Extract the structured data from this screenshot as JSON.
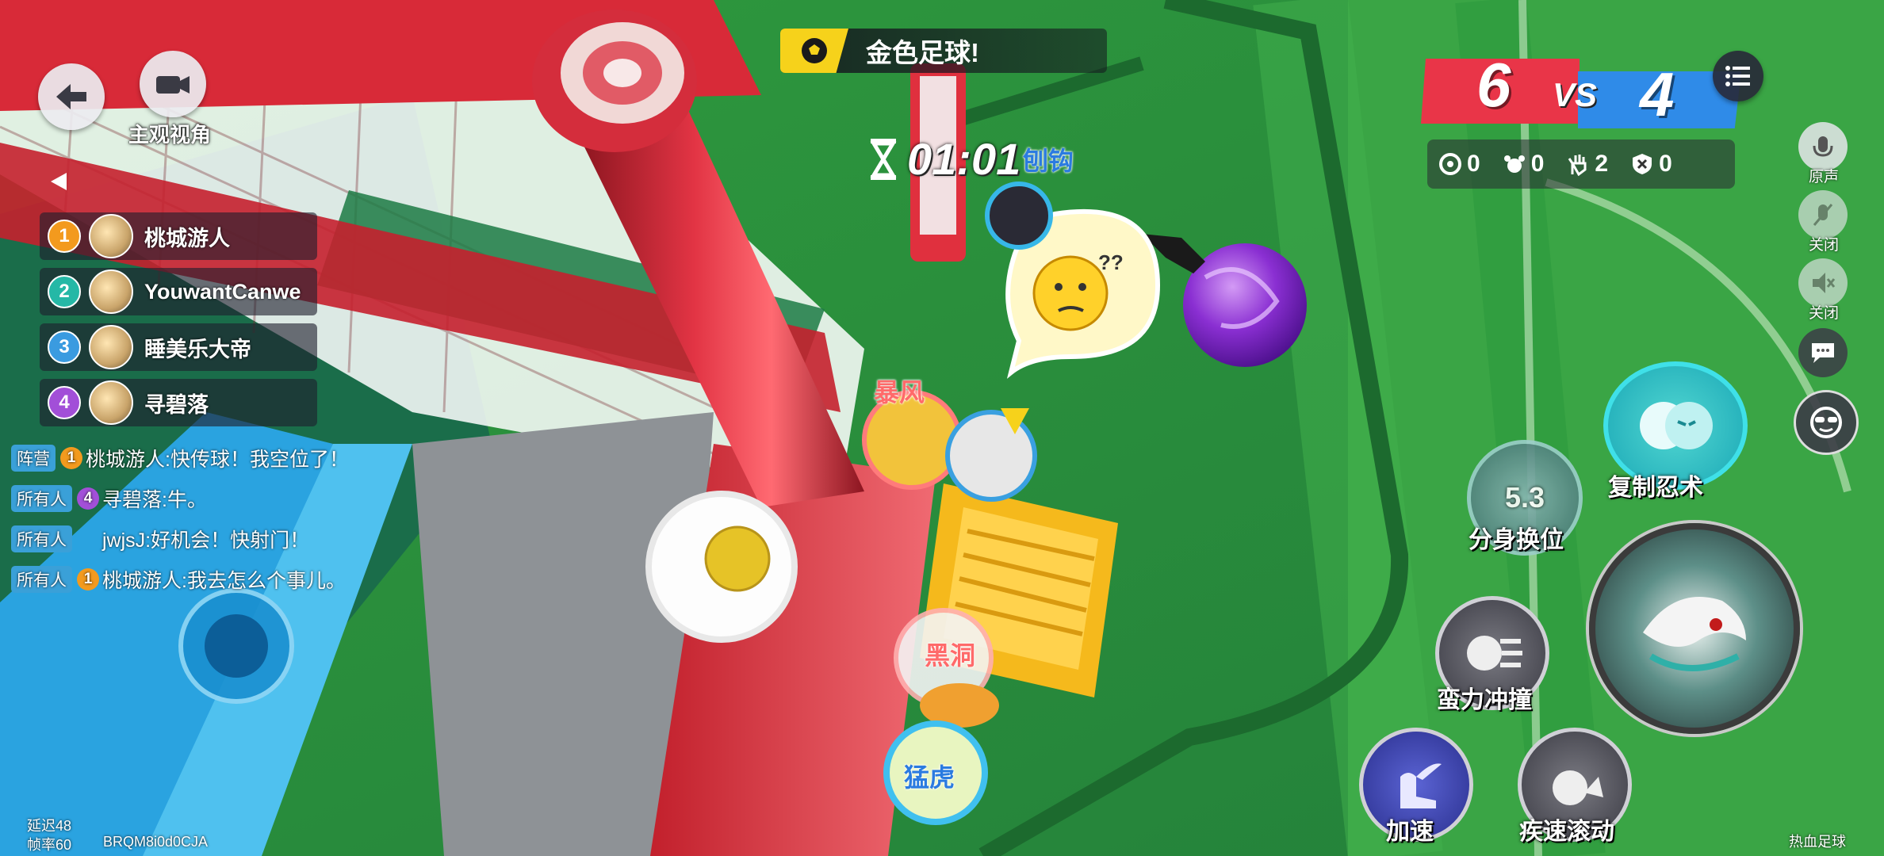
{
  "top_left": {
    "perspective_label": "主观视角"
  },
  "players": [
    {
      "rank": "1",
      "name": "桃城游人",
      "color": "#f39a1e"
    },
    {
      "rank": "2",
      "name": "YouwantCanwe",
      "color": "#25b8a6"
    },
    {
      "rank": "3",
      "name": "睡美乐大帝",
      "color": "#3a9be0"
    },
    {
      "rank": "4",
      "name": "寻碧落",
      "color": "#a24fd8"
    }
  ],
  "chat": [
    {
      "tag": "阵营",
      "rank": "1",
      "text": "桃城游人:快传球！我空位了！"
    },
    {
      "tag": "所有人",
      "rank": "4",
      "text": "寻碧落:牛。"
    },
    {
      "tag": "所有人",
      "rank": "",
      "text": "jwjsJ:好机会！快射门！"
    },
    {
      "tag": "所有人",
      "rank": "1",
      "text": "桃城游人:我去怎么个事儿。"
    }
  ],
  "banner": {
    "text": "金色足球!"
  },
  "timer": {
    "text": "01:01"
  },
  "scoreboard": {
    "red_score": "6",
    "vs": "VS",
    "blue_score": "4",
    "stats": [
      {
        "icon": "goal-icon",
        "value": "0"
      },
      {
        "icon": "save-icon",
        "value": "0"
      },
      {
        "icon": "assist-icon",
        "value": "2"
      },
      {
        "icon": "shield-icon",
        "value": "0"
      }
    ]
  },
  "side_buttons": {
    "original_label": "原声",
    "mic_label": "关闭",
    "speaker_label": "关闭"
  },
  "skills": {
    "copy_ninjutsu": "复制忍术",
    "clone_swap": "分身换位",
    "clone_swap_cooldown": "5.3",
    "brute_charge": "蛮力冲撞",
    "speed_up": "加速",
    "fast_roll": "疾速滚动"
  },
  "characters": {
    "storm": "暴风",
    "black_hole": "黑洞",
    "tiger": "猛虎",
    "hook": "刨钩"
  },
  "footer": {
    "latency": "延迟48",
    "fps": "帧率60",
    "room_id": "BRQM8i0d0CJA",
    "mode": "热血足球"
  },
  "colors": {
    "red_team": "#e93548",
    "blue_team": "#2f8be8",
    "gold": "#f6d21b"
  }
}
